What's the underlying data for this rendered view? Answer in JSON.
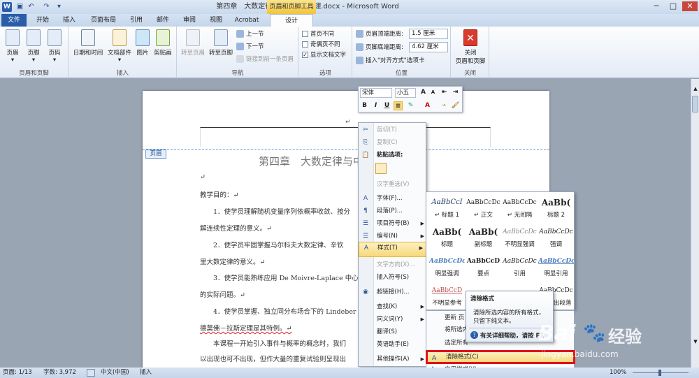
{
  "window": {
    "title": "第四章　大数定律与中心极限定理.docx - Microsoft Word",
    "context_tool": "页眉和页脚工具",
    "app_icon": "W"
  },
  "tabs": [
    {
      "label": "文件"
    },
    {
      "label": "开始"
    },
    {
      "label": "插入"
    },
    {
      "label": "页面布局"
    },
    {
      "label": "引用"
    },
    {
      "label": "邮件"
    },
    {
      "label": "审阅"
    },
    {
      "label": "视图"
    },
    {
      "label": "Acrobat"
    },
    {
      "label": "设计"
    }
  ],
  "ribbon": {
    "groups": {
      "hf": "页眉和页脚",
      "insert": "插入",
      "nav": "导航",
      "options": "选项",
      "position": "位置",
      "close": "关闭"
    },
    "header": "页眉",
    "footer": "页脚",
    "pagenum": "页码",
    "datetime": "日期和时间",
    "docparts": "文档部件",
    "picture": "图片",
    "clipart": "剪贴画",
    "goto_header": "转至页眉",
    "goto_footer": "转至页脚",
    "prev": "上一节",
    "next": "下一节",
    "link_prev": "链接到前一条页眉",
    "opt1": "首页不同",
    "opt2": "奇偶页不同",
    "opt3": "显示文档文字",
    "header_dist_label": "页眉顶端距离:",
    "header_dist_value": "1.5 厘米",
    "footer_dist_label": "页脚底端距离:",
    "footer_dist_value": "4.62 厘米",
    "insert_align_tab": "插入\"对齐方式\"选项卡",
    "close_label": "关闭",
    "close_label2": "页眉和页脚"
  },
  "document": {
    "header_tag": "页眉",
    "header_mark": "↵",
    "heading": "第四章　大数定律与中心极限定理",
    "lines": [
      "↵",
      "教学目的：↵",
      "　　1．使学员理解随机变量序列依概率收敛、按分",
      "解连续性定理的意义。↵",
      "　　2．使学员牢固掌握马尔科夫大数定律、辛钦",
      "里大数定律的意义。↵",
      "　　3．使学员能熟练应用 De  Moivre-Laplace 中心",
      "的实际问题。↵",
      "　　4．使学员掌握、独立同分布场合下的 Lindeber",
      "德莫佛－拉斯定理是其特例。↵",
      "　　本课程一开始引入事件与概率的概念时，我们",
      "以出现也可不出现，但作大量的重复试验则呈现出"
    ]
  },
  "minitoolbar": {
    "font": "宋体",
    "size": "小五",
    "grow": "A",
    "shrink": "A",
    "bold": "B",
    "italic": "I",
    "underline": "U"
  },
  "context_menu": {
    "items": [
      {
        "icon": "✂",
        "label": "剪切(T)",
        "disabled": true
      },
      {
        "icon": "⎘",
        "label": "复制(C)",
        "disabled": true
      },
      {
        "icon": "📋",
        "label": "粘贴选项:",
        "disabled": false
      },
      {
        "icon": "",
        "label": "汉字重选(V)",
        "disabled": true
      },
      {
        "icon": "A",
        "label": "字体(F)...",
        "disabled": false
      },
      {
        "icon": "¶",
        "label": "段落(P)...",
        "disabled": false
      },
      {
        "icon": "☰",
        "label": "项目符号(B)",
        "disabled": false,
        "sub": true
      },
      {
        "icon": "☰",
        "label": "编号(N)",
        "disabled": false,
        "sub": true
      },
      {
        "icon": "A",
        "label": "样式(T)",
        "disabled": false,
        "sub": true,
        "highlight": true
      },
      {
        "icon": "",
        "label": "文字方向(X)...",
        "disabled": true
      },
      {
        "icon": "",
        "label": "插入符号(S)",
        "disabled": false
      },
      {
        "icon": "◉",
        "label": "超链接(H)...",
        "disabled": false
      },
      {
        "icon": "",
        "label": "查找(K)",
        "disabled": false,
        "sub": true
      },
      {
        "icon": "",
        "label": "同义词(Y)",
        "disabled": false,
        "sub": true
      },
      {
        "icon": "",
        "label": "翻译(S)",
        "disabled": false
      },
      {
        "icon": "",
        "label": "英语助手(E)",
        "disabled": false
      },
      {
        "icon": "",
        "label": "其他操作(A)",
        "disabled": false,
        "sub": true
      }
    ]
  },
  "styles": [
    {
      "preview": "AaBbCcI",
      "name": "↵ 标题 1"
    },
    {
      "preview": "AaBbCcDc",
      "name": "↵ 正文"
    },
    {
      "preview": "AaBbCcDc",
      "name": "↵ 无间隔"
    },
    {
      "preview": "AaBb(",
      "name": "标题 2"
    },
    {
      "preview": "AaBb(",
      "name": "标题"
    },
    {
      "preview": "AaBb(",
      "name": "副标题"
    },
    {
      "preview": "AaBbCcDc",
      "name": "不明显强调"
    },
    {
      "preview": "AaBbCcDc",
      "name": "强调"
    },
    {
      "preview": "AaBbCcDc",
      "name": "明显强调"
    },
    {
      "preview": "AaBbCcD",
      "name": "要点"
    },
    {
      "preview": "AaBbCcDc",
      "name": "引用"
    },
    {
      "preview": "AaBbCcDc",
      "name": "明显引用"
    },
    {
      "preview": "AaBbCcD",
      "name": "不明显参考"
    },
    {
      "preview": "",
      "name": ""
    },
    {
      "preview": "",
      "name": ""
    },
    {
      "preview": "AaBbCcDc",
      "name": "↵ 列出段落"
    }
  ],
  "styles_menu": {
    "i1": "更新 页",
    "i2": "将所选内",
    "i3": "选定所有",
    "clear": "清除格式(C)",
    "apply": "应用样式(Y)..."
  },
  "tooltip": {
    "title": "清除格式",
    "body1": "清除所选内容的所有格式，",
    "body2": "只留下纯文本。",
    "help": "有关详细帮助，请按 F1"
  },
  "status": {
    "page": "页面: 1/13",
    "words": "字数: 3,972",
    "lang": "中文(中国)",
    "mode": "插入",
    "zoom": "100%"
  },
  "watermark": {
    "brand": "Bai",
    "brand2": "经验",
    "url": "jingyan.baidu.com"
  },
  "colors": {
    "accent": "#2a5ca8",
    "red": "#e0111b",
    "highlight": "#f7d97a"
  }
}
